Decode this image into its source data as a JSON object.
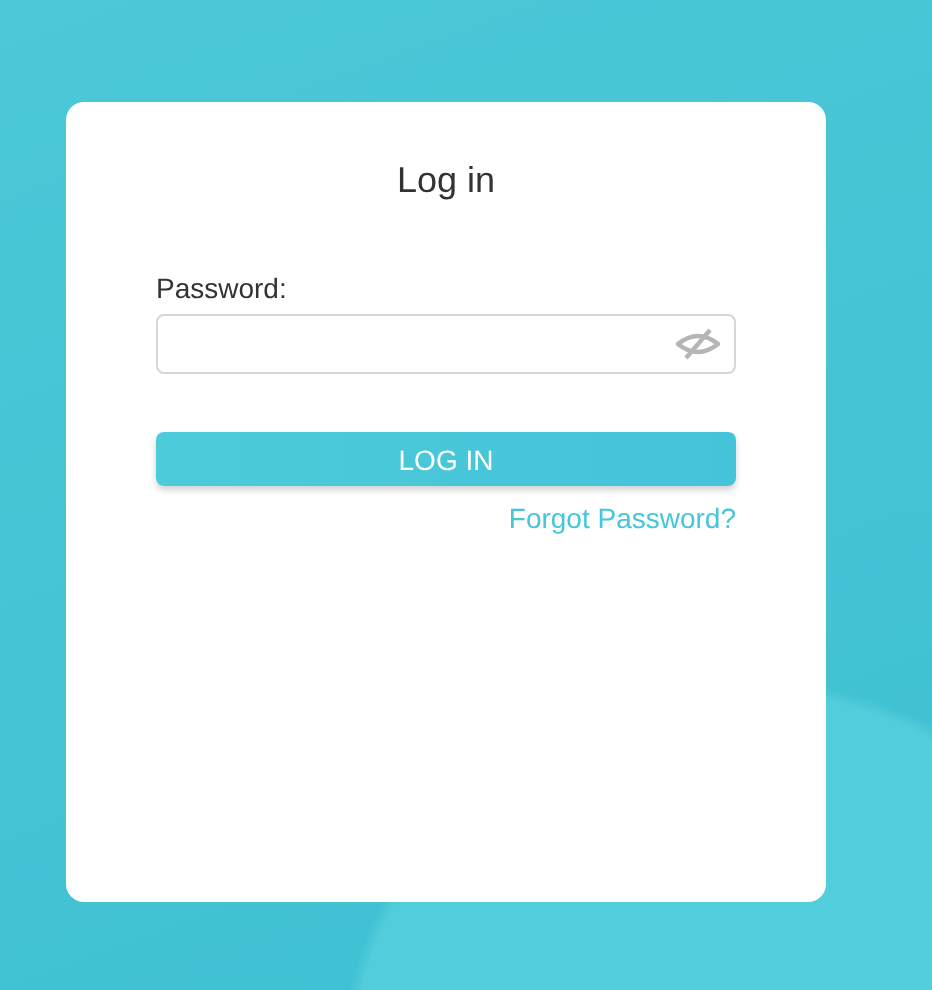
{
  "dialog": {
    "title": "Log in"
  },
  "password": {
    "label": "Password:"
  },
  "login_button": {
    "label": "LOG IN"
  },
  "forgot_link": {
    "label": "Forgot Password?"
  }
}
